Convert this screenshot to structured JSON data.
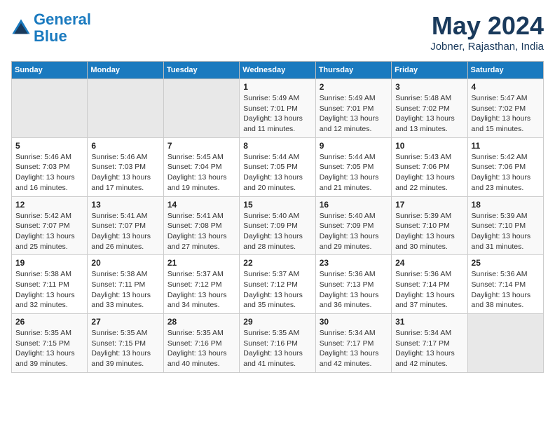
{
  "header": {
    "logo_line1": "General",
    "logo_line2": "Blue",
    "month": "May 2024",
    "location": "Jobner, Rajasthan, India"
  },
  "weekdays": [
    "Sunday",
    "Monday",
    "Tuesday",
    "Wednesday",
    "Thursday",
    "Friday",
    "Saturday"
  ],
  "weeks": [
    [
      {
        "day": "",
        "info": ""
      },
      {
        "day": "",
        "info": ""
      },
      {
        "day": "",
        "info": ""
      },
      {
        "day": "1",
        "info": "Sunrise: 5:49 AM\nSunset: 7:01 PM\nDaylight: 13 hours and 11 minutes."
      },
      {
        "day": "2",
        "info": "Sunrise: 5:49 AM\nSunset: 7:01 PM\nDaylight: 13 hours and 12 minutes."
      },
      {
        "day": "3",
        "info": "Sunrise: 5:48 AM\nSunset: 7:02 PM\nDaylight: 13 hours and 13 minutes."
      },
      {
        "day": "4",
        "info": "Sunrise: 5:47 AM\nSunset: 7:02 PM\nDaylight: 13 hours and 15 minutes."
      }
    ],
    [
      {
        "day": "5",
        "info": "Sunrise: 5:46 AM\nSunset: 7:03 PM\nDaylight: 13 hours and 16 minutes."
      },
      {
        "day": "6",
        "info": "Sunrise: 5:46 AM\nSunset: 7:03 PM\nDaylight: 13 hours and 17 minutes."
      },
      {
        "day": "7",
        "info": "Sunrise: 5:45 AM\nSunset: 7:04 PM\nDaylight: 13 hours and 19 minutes."
      },
      {
        "day": "8",
        "info": "Sunrise: 5:44 AM\nSunset: 7:05 PM\nDaylight: 13 hours and 20 minutes."
      },
      {
        "day": "9",
        "info": "Sunrise: 5:44 AM\nSunset: 7:05 PM\nDaylight: 13 hours and 21 minutes."
      },
      {
        "day": "10",
        "info": "Sunrise: 5:43 AM\nSunset: 7:06 PM\nDaylight: 13 hours and 22 minutes."
      },
      {
        "day": "11",
        "info": "Sunrise: 5:42 AM\nSunset: 7:06 PM\nDaylight: 13 hours and 23 minutes."
      }
    ],
    [
      {
        "day": "12",
        "info": "Sunrise: 5:42 AM\nSunset: 7:07 PM\nDaylight: 13 hours and 25 minutes."
      },
      {
        "day": "13",
        "info": "Sunrise: 5:41 AM\nSunset: 7:07 PM\nDaylight: 13 hours and 26 minutes."
      },
      {
        "day": "14",
        "info": "Sunrise: 5:41 AM\nSunset: 7:08 PM\nDaylight: 13 hours and 27 minutes."
      },
      {
        "day": "15",
        "info": "Sunrise: 5:40 AM\nSunset: 7:09 PM\nDaylight: 13 hours and 28 minutes."
      },
      {
        "day": "16",
        "info": "Sunrise: 5:40 AM\nSunset: 7:09 PM\nDaylight: 13 hours and 29 minutes."
      },
      {
        "day": "17",
        "info": "Sunrise: 5:39 AM\nSunset: 7:10 PM\nDaylight: 13 hours and 30 minutes."
      },
      {
        "day": "18",
        "info": "Sunrise: 5:39 AM\nSunset: 7:10 PM\nDaylight: 13 hours and 31 minutes."
      }
    ],
    [
      {
        "day": "19",
        "info": "Sunrise: 5:38 AM\nSunset: 7:11 PM\nDaylight: 13 hours and 32 minutes."
      },
      {
        "day": "20",
        "info": "Sunrise: 5:38 AM\nSunset: 7:11 PM\nDaylight: 13 hours and 33 minutes."
      },
      {
        "day": "21",
        "info": "Sunrise: 5:37 AM\nSunset: 7:12 PM\nDaylight: 13 hours and 34 minutes."
      },
      {
        "day": "22",
        "info": "Sunrise: 5:37 AM\nSunset: 7:12 PM\nDaylight: 13 hours and 35 minutes."
      },
      {
        "day": "23",
        "info": "Sunrise: 5:36 AM\nSunset: 7:13 PM\nDaylight: 13 hours and 36 minutes."
      },
      {
        "day": "24",
        "info": "Sunrise: 5:36 AM\nSunset: 7:14 PM\nDaylight: 13 hours and 37 minutes."
      },
      {
        "day": "25",
        "info": "Sunrise: 5:36 AM\nSunset: 7:14 PM\nDaylight: 13 hours and 38 minutes."
      }
    ],
    [
      {
        "day": "26",
        "info": "Sunrise: 5:35 AM\nSunset: 7:15 PM\nDaylight: 13 hours and 39 minutes."
      },
      {
        "day": "27",
        "info": "Sunrise: 5:35 AM\nSunset: 7:15 PM\nDaylight: 13 hours and 39 minutes."
      },
      {
        "day": "28",
        "info": "Sunrise: 5:35 AM\nSunset: 7:16 PM\nDaylight: 13 hours and 40 minutes."
      },
      {
        "day": "29",
        "info": "Sunrise: 5:35 AM\nSunset: 7:16 PM\nDaylight: 13 hours and 41 minutes."
      },
      {
        "day": "30",
        "info": "Sunrise: 5:34 AM\nSunset: 7:17 PM\nDaylight: 13 hours and 42 minutes."
      },
      {
        "day": "31",
        "info": "Sunrise: 5:34 AM\nSunset: 7:17 PM\nDaylight: 13 hours and 42 minutes."
      },
      {
        "day": "",
        "info": ""
      }
    ]
  ]
}
